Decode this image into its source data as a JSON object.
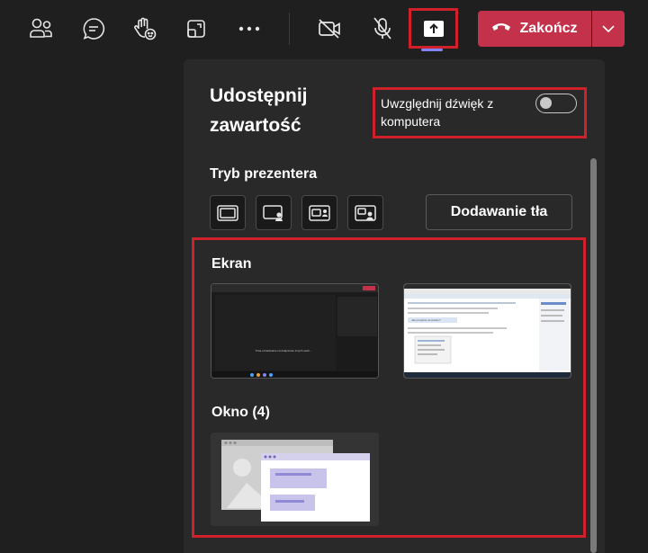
{
  "toolbar": {
    "icons": [
      "people-icon",
      "chat-icon",
      "raise-hand-icon",
      "layout-icon",
      "more-icon",
      "camera-off-icon",
      "mic-off-icon",
      "share-screen-icon"
    ],
    "end_call_label": "Zakończ",
    "end_call_color": "#c4314b",
    "accent": "#7f85f5",
    "highlight_color": "#d0202a"
  },
  "share_panel": {
    "title": "Udostępnij zawartość",
    "include_audio_label": "Uwzględnij dźwięk z komputera",
    "include_audio_on": false,
    "presenter_mode_label": "Tryb prezentera",
    "presenter_modes": [
      "content-only",
      "standout",
      "side-by-side",
      "reporter"
    ],
    "add_background_label": "Dodawanie tła",
    "screen_section_label": "Ekran",
    "screens": [
      {
        "caption": "Trwa oczekiwanie na dołączenie innych osób..."
      },
      {
        "caption": "Jak przejście do Adobe?"
      }
    ],
    "window_section_label": "Okno (4)"
  }
}
